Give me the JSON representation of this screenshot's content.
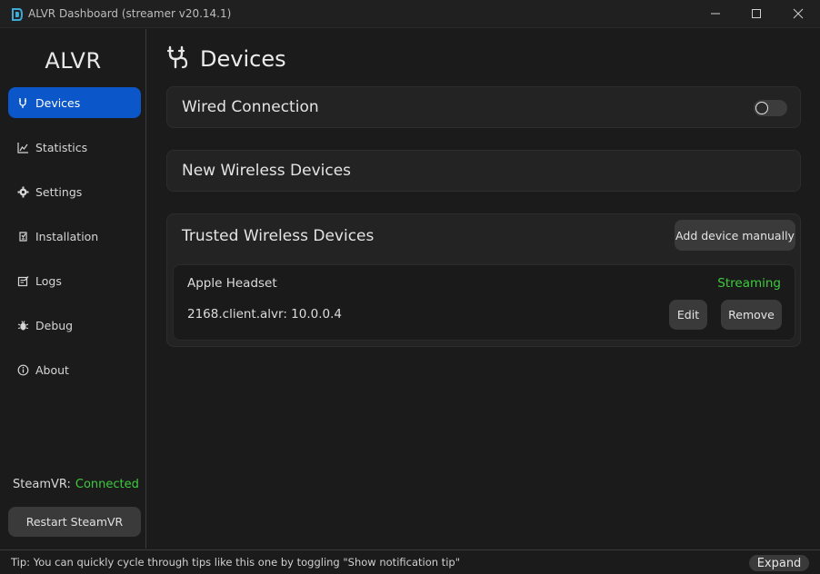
{
  "window": {
    "title": "ALVR Dashboard (streamer v20.14.1)",
    "app_icon": "alvr-logo-icon",
    "controls": [
      "minimize-icon",
      "maximize-icon",
      "close-icon"
    ]
  },
  "sidebar": {
    "brand": "ALVR",
    "items": [
      {
        "label": "Devices",
        "icon": "plug-icon",
        "active": true
      },
      {
        "label": "Statistics",
        "icon": "chart-icon",
        "active": false
      },
      {
        "label": "Settings",
        "icon": "gear-icon",
        "active": false
      },
      {
        "label": "Installation",
        "icon": "installation-icon",
        "active": false
      },
      {
        "label": "Logs",
        "icon": "logs-icon",
        "active": false
      },
      {
        "label": "Debug",
        "icon": "bug-icon",
        "active": false
      },
      {
        "label": "About",
        "icon": "info-icon",
        "active": false
      }
    ],
    "steamvr_label": "SteamVR:",
    "steamvr_status": "Connected",
    "restart_label": "Restart SteamVR"
  },
  "main": {
    "title": "Devices",
    "title_icon": "plug-icon",
    "wired": {
      "title": "Wired Connection",
      "toggle_on": false
    },
    "new_wireless": {
      "title": "New Wireless Devices"
    },
    "trusted": {
      "title": "Trusted Wireless Devices",
      "add_label": "Add device manually",
      "devices": [
        {
          "name": "Apple Headset",
          "status": "Streaming",
          "address": "2168.client.alvr: 10.0.0.4",
          "edit_label": "Edit",
          "remove_label": "Remove"
        }
      ]
    }
  },
  "footer": {
    "tip": "Tip: You can quickly cycle through tips like this one by toggling \"Show notification tip\"",
    "expand_label": "Expand"
  },
  "colors": {
    "accent": "#0b56c8",
    "success": "#3ecb3e",
    "background": "#1b1b1b",
    "card": "#232323",
    "button": "#3a3a3a"
  }
}
